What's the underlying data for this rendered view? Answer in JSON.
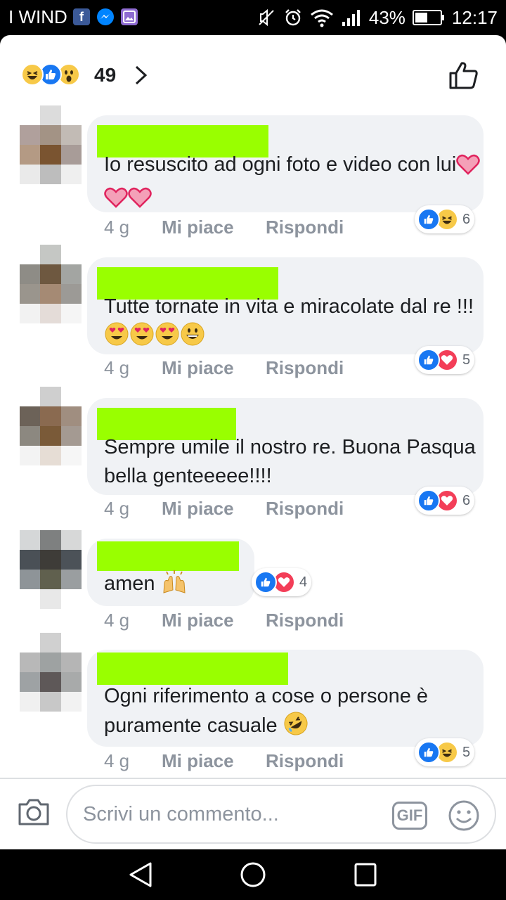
{
  "status_bar": {
    "carrier": "I WIND",
    "battery": "43%",
    "time": "12:17",
    "apps": [
      "facebook-icon",
      "messenger-icon",
      "gallery-icon"
    ]
  },
  "header": {
    "reaction_count": "49",
    "reactions": [
      "haha",
      "like",
      "wow"
    ]
  },
  "comments": [
    {
      "text": "Io resuscito ad ogni foto e video con lui",
      "trailing_emoji": [
        "heart",
        "heart",
        "heart"
      ],
      "time": "4 g",
      "like_label": "Mi piace",
      "reply_label": "Rispondi",
      "reactions": [
        "like",
        "haha"
      ],
      "reaction_count": "6"
    },
    {
      "text": "Tutte tornate in vita e miracolate dal re !!!",
      "trailing_emoji": [
        "heart-eyes",
        "heart-eyes",
        "heart-eyes",
        "grin"
      ],
      "time": "4 g",
      "like_label": "Mi piace",
      "reply_label": "Rispondi",
      "reactions": [
        "like",
        "love"
      ],
      "reaction_count": "5"
    },
    {
      "text": "Sempre umile il nostro re. Buona Pasqua bella genteeeee!!!!",
      "trailing_emoji": [],
      "time": "4 g",
      "like_label": "Mi piace",
      "reply_label": "Rispondi",
      "reactions": [
        "like",
        "love"
      ],
      "reaction_count": "6"
    },
    {
      "text": "amen",
      "trailing_emoji": [
        "raised-hands"
      ],
      "time": "4 g",
      "like_label": "Mi piace",
      "reply_label": "Rispondi",
      "reactions": [
        "like",
        "love"
      ],
      "reaction_count": "4"
    },
    {
      "text": "Ogni riferimento a cose o persone è puramente casuale",
      "trailing_emoji": [
        "rofl"
      ],
      "time": "4 g",
      "like_label": "Mi piace",
      "reply_label": "Rispondi",
      "reactions": [
        "like",
        "haha"
      ],
      "reaction_count": "5"
    }
  ],
  "composer": {
    "placeholder": "Scrivi un commento...",
    "gif_label": "GIF"
  },
  "colors": {
    "facebook_blue": "#1877f2",
    "love_red": "#f33e58",
    "name_redaction": "#99ff00",
    "bubble": "#f0f2f5",
    "meta_text": "#8d949e"
  }
}
